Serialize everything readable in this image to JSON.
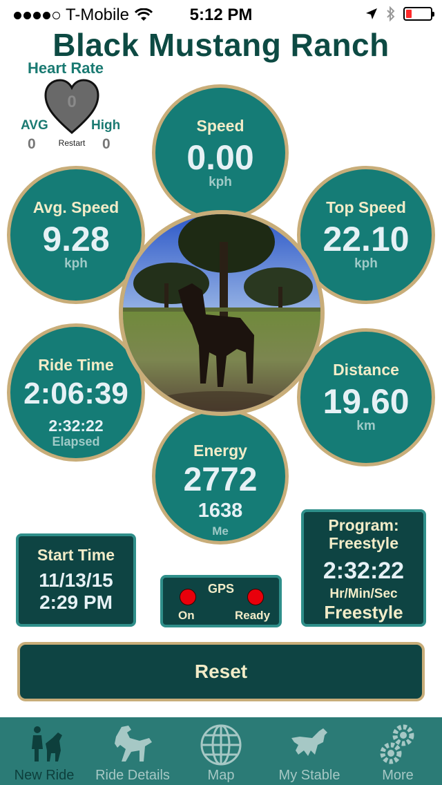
{
  "status_bar": {
    "carrier": "T-Mobile",
    "time": "5:12 PM",
    "signal_bars": 4,
    "battery_level": 0.15
  },
  "title": "Black Mustang Ranch",
  "heart_rate": {
    "label": "Heart Rate",
    "value": "0",
    "avg_label": "AVG",
    "avg_value": "0",
    "high_label": "High",
    "high_value": "0",
    "restart_label": "Restart"
  },
  "speed": {
    "label": "Speed",
    "value": "0.00",
    "unit": "kph"
  },
  "avg_speed": {
    "label": "Avg. Speed",
    "value": "9.28",
    "unit": "kph"
  },
  "top_speed": {
    "label": "Top Speed",
    "value": "22.10",
    "unit": "kph"
  },
  "ride_time": {
    "label": "Ride Time",
    "value": "2:06:39",
    "elapsed_value": "2:32:22",
    "elapsed_label": "Elapsed"
  },
  "distance": {
    "label": "Distance",
    "value": "19.60",
    "unit": "km"
  },
  "energy": {
    "label": "Energy",
    "value": "2772",
    "sub_value": "1638",
    "sub_label": "Me"
  },
  "start_time": {
    "label": "Start Time",
    "date": "11/13/15",
    "time": "2:29 PM"
  },
  "gps": {
    "label": "GPS",
    "left_label": "On",
    "right_label": "Ready",
    "indicator_color": "#e8000b"
  },
  "program": {
    "label": "Program:",
    "name": "Freestyle",
    "time": "2:32:22",
    "unit": "Hr/Min/Sec",
    "mode": "Freestyle"
  },
  "reset_label": "Reset",
  "tabs": [
    {
      "label": "New Ride",
      "icon": "rider-icon",
      "active": true
    },
    {
      "label": "Ride Details",
      "icon": "rearing-horse-icon",
      "active": false
    },
    {
      "label": "Map",
      "icon": "globe-icon",
      "active": false
    },
    {
      "label": "My Stable",
      "icon": "running-horse-icon",
      "active": false
    },
    {
      "label": "More",
      "icon": "gears-icon",
      "active": false
    }
  ],
  "colors": {
    "teal": "#157c76",
    "gold": "#c8ad79",
    "dark": "#0e4443",
    "title": "#0d4a43"
  }
}
